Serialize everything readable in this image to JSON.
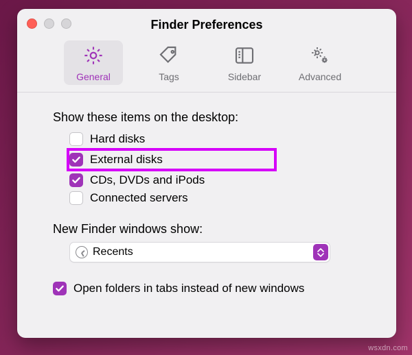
{
  "window": {
    "title": "Finder Preferences"
  },
  "toolbar": {
    "items": [
      {
        "label": "General",
        "selected": true
      },
      {
        "label": "Tags",
        "selected": false
      },
      {
        "label": "Sidebar",
        "selected": false
      },
      {
        "label": "Advanced",
        "selected": false
      }
    ]
  },
  "desktop_items": {
    "heading": "Show these items on the desktop:",
    "options": [
      {
        "label": "Hard disks",
        "checked": false,
        "highlighted": false
      },
      {
        "label": "External disks",
        "checked": true,
        "highlighted": true
      },
      {
        "label": "CDs, DVDs and iPods",
        "checked": true,
        "highlighted": false
      },
      {
        "label": "Connected servers",
        "checked": false,
        "highlighted": false
      }
    ]
  },
  "new_window": {
    "heading": "New Finder windows show:",
    "value": "Recents"
  },
  "open_in_tabs": {
    "label": "Open folders in tabs instead of new windows",
    "checked": true
  },
  "colors": {
    "accent": "#9f33b8",
    "highlight": "#d500f9"
  },
  "watermark": "wsxdn.com"
}
